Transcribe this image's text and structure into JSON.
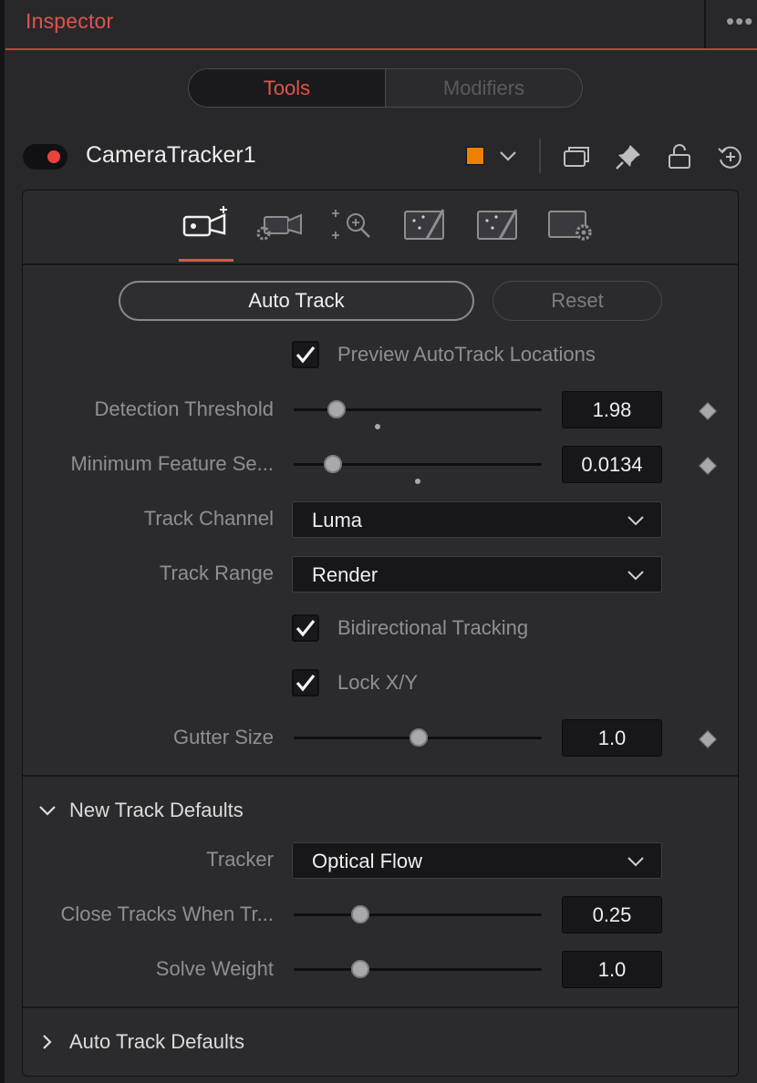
{
  "header": {
    "title": "Inspector",
    "more_glyph": "•••"
  },
  "tabs": {
    "tools": "Tools",
    "modifiers": "Modifiers"
  },
  "node": {
    "name": "CameraTracker1",
    "color": "#f08000",
    "icons": [
      "chevron-down-icon",
      "windows-icon",
      "pin-icon",
      "lock-icon",
      "reset-icon"
    ]
  },
  "tool_tabs": [
    "track-camera-icon",
    "camera-settings-icon",
    "solve-zoom-icon",
    "export-wand-icon",
    "refine-wand-icon",
    "options-gear-icon"
  ],
  "buttons": {
    "auto_track": "Auto Track",
    "reset": "Reset"
  },
  "preview_autotrack": {
    "label": "Preview AutoTrack Locations",
    "checked": true
  },
  "detection_threshold": {
    "label": "Detection Threshold",
    "value": "1.98"
  },
  "min_feature": {
    "label": "Minimum Feature Se...",
    "value": "0.0134"
  },
  "track_channel": {
    "label": "Track Channel",
    "value": "Luma"
  },
  "track_range": {
    "label": "Track Range",
    "value": "Render"
  },
  "bidirectional": {
    "label": "Bidirectional Tracking",
    "checked": true
  },
  "lock_xy": {
    "label": "Lock X/Y",
    "checked": true
  },
  "gutter_size": {
    "label": "Gutter Size",
    "value": "1.0"
  },
  "new_track_defaults": {
    "title": "New Track Defaults",
    "expanded": true,
    "tracker": {
      "label": "Tracker",
      "value": "Optical Flow"
    },
    "close_tracks": {
      "label": "Close Tracks When Tr...",
      "value": "0.25"
    },
    "solve_weight": {
      "label": "Solve Weight",
      "value": "1.0"
    }
  },
  "auto_track_defaults": {
    "title": "Auto Track Defaults",
    "expanded": false
  },
  "colors": {
    "accent": "#e0544b",
    "panel": "#2b2b2e",
    "field": "#17171a"
  }
}
